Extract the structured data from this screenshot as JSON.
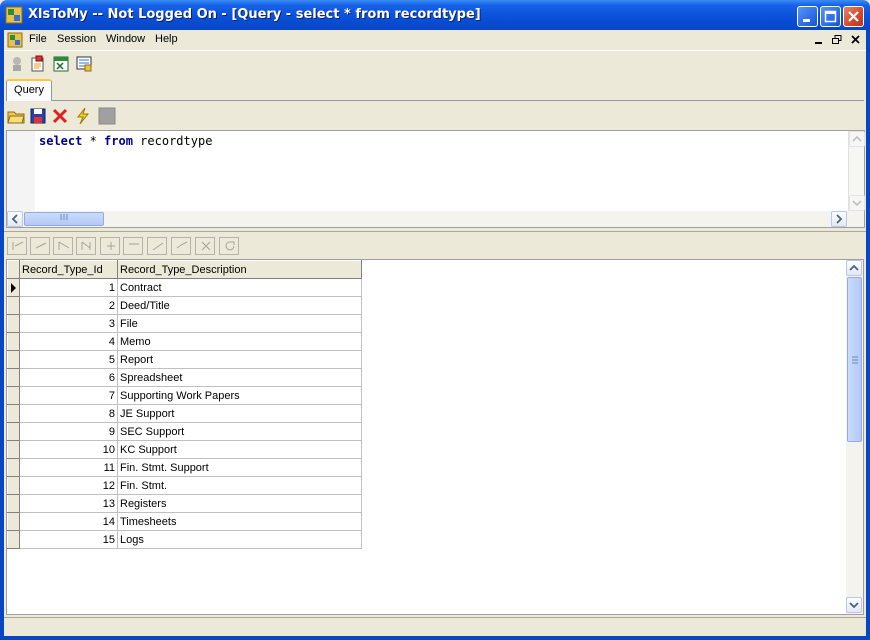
{
  "window": {
    "title": "XlsToMy -- Not Logged On - [Query - select * from recordtype]"
  },
  "menu": {
    "items": [
      "File",
      "Session",
      "Window",
      "Help"
    ]
  },
  "tabs": [
    {
      "label": "Query",
      "active": true
    }
  ],
  "editor": {
    "sql_tokens": [
      {
        "text": "select",
        "keyword": true
      },
      {
        "text": " * ",
        "keyword": false
      },
      {
        "text": "from",
        "keyword": true
      },
      {
        "text": " recordtype",
        "keyword": false
      }
    ]
  },
  "grid": {
    "columns": [
      "Record_Type_Id",
      "Record_Type_Description"
    ],
    "rows": [
      {
        "id": "1",
        "desc": "Contract"
      },
      {
        "id": "2",
        "desc": "Deed/Title"
      },
      {
        "id": "3",
        "desc": "File"
      },
      {
        "id": "4",
        "desc": "Memo"
      },
      {
        "id": "5",
        "desc": "Report"
      },
      {
        "id": "6",
        "desc": "Spreadsheet"
      },
      {
        "id": "7",
        "desc": "Supporting Work Papers"
      },
      {
        "id": "8",
        "desc": "JE Support"
      },
      {
        "id": "9",
        "desc": "SEC Support"
      },
      {
        "id": "10",
        "desc": "KC Support"
      },
      {
        "id": "11",
        "desc": "Fin. Stmt. Support"
      },
      {
        "id": "12",
        "desc": "Fin. Stmt."
      },
      {
        "id": "13",
        "desc": "Registers"
      },
      {
        "id": "14",
        "desc": "Timesheets"
      },
      {
        "id": "15",
        "desc": "Logs"
      }
    ],
    "current_row": 0
  },
  "colors": {
    "title_bar": "#0a4fd8",
    "keyword": "#00008b",
    "tab_highlight": "#ffc83c"
  }
}
